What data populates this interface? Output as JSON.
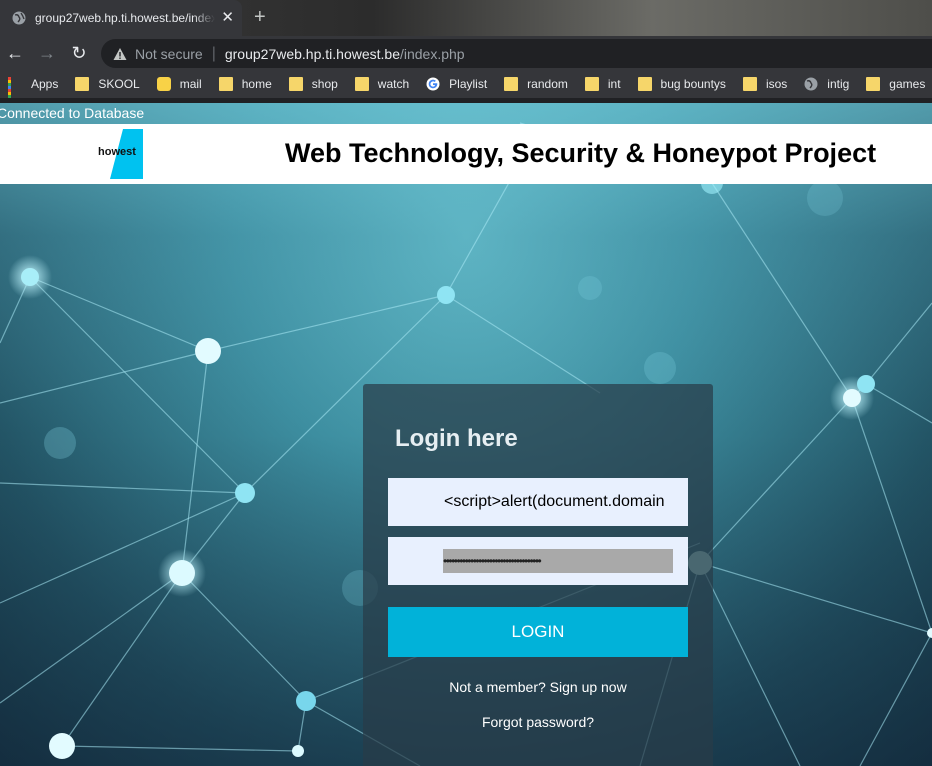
{
  "browser": {
    "tab_title": "group27web.hp.ti.howest.be/index.php",
    "not_secure_label": "Not secure",
    "url_host": "group27web.hp.ti.howest.be",
    "url_path": "/index.php",
    "bookmarks": [
      {
        "label": "Apps",
        "icon": "apps-grid-icon"
      },
      {
        "label": "SKOOL",
        "icon": "folder-icon"
      },
      {
        "label": "mail",
        "icon": "mail-app-icon"
      },
      {
        "label": "home",
        "icon": "folder-icon"
      },
      {
        "label": "shop",
        "icon": "folder-icon"
      },
      {
        "label": "watch",
        "icon": "folder-icon"
      },
      {
        "label": "Playlist",
        "icon": "google-icon"
      },
      {
        "label": "random",
        "icon": "folder-icon"
      },
      {
        "label": "int",
        "icon": "folder-icon"
      },
      {
        "label": "bug bountys",
        "icon": "folder-icon"
      },
      {
        "label": "isos",
        "icon": "folder-icon"
      },
      {
        "label": "intig",
        "icon": "globe-icon"
      },
      {
        "label": "games",
        "icon": "folder-icon"
      }
    ]
  },
  "page": {
    "status_message": "Connected to Database",
    "logo_text": "howest",
    "site_title": "Web Technology, Security & Honeypot Project",
    "login": {
      "heading": "Login here",
      "username_value": "<script>alert(document.domain",
      "password_mask": "••••••••••••••••••••••••••••••••••••",
      "button_label": "LOGIN",
      "signup_link": "Not a member? Sign up now",
      "forgot_link": "Forgot password?"
    }
  },
  "colors": {
    "accent": "#01b2d9",
    "logo_accent": "#00c2f0",
    "field_bg": "#e8f0fe"
  }
}
